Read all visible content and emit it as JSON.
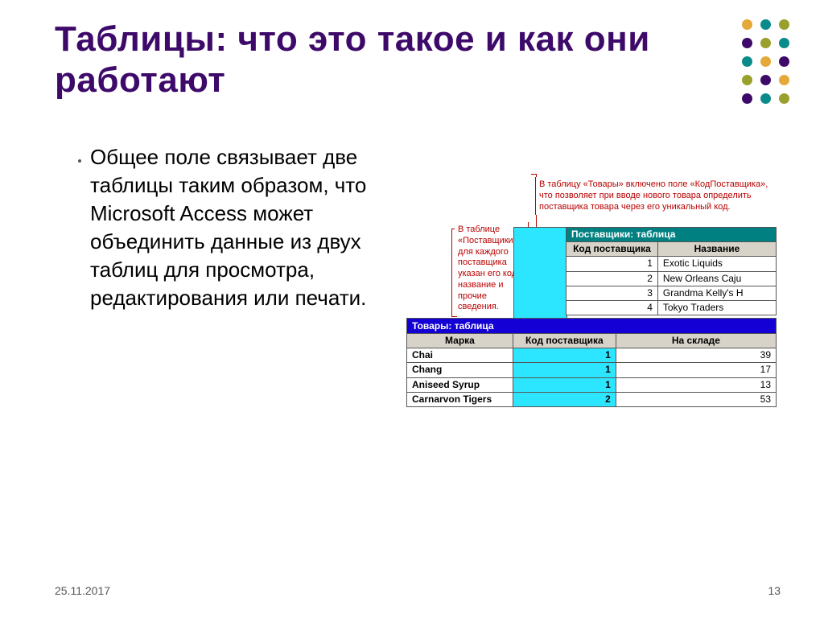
{
  "title": "Таблицы: что это такое и как они работают",
  "bullet": "Общее поле связывает две таблицы таким образом, что Microsoft Access может объединить данные из двух таблиц для просмотра, редактирования или печати.",
  "footer_date": "25.11.2017",
  "page_num": "13",
  "notes": {
    "left": "В таблице «Поставщики» для каждого поставщика указан его код, название и прочие сведения.",
    "right": "В таблицу «Товары» включено поле «КодПоставщика», что позволяет при вводе нового товара определить поставщика товара через его уникальный код."
  },
  "suppliers": {
    "caption": "Поставщики: таблица",
    "headers": [
      "Код поставщика",
      "Название"
    ],
    "rows": [
      [
        "1",
        "Exotic Liquids"
      ],
      [
        "2",
        "New Orleans Caju"
      ],
      [
        "3",
        "Grandma Kelly's H"
      ],
      [
        "4",
        "Tokyo Traders"
      ]
    ]
  },
  "products": {
    "caption": "Товары: таблица",
    "headers": [
      "Марка",
      "Код поставщика",
      "На складе"
    ],
    "rows": [
      [
        "Chai",
        "1",
        "39"
      ],
      [
        "Chang",
        "1",
        "17"
      ],
      [
        "Aniseed Syrup",
        "1",
        "13"
      ],
      [
        "Carnarvon Tigers",
        "2",
        "53"
      ]
    ]
  }
}
